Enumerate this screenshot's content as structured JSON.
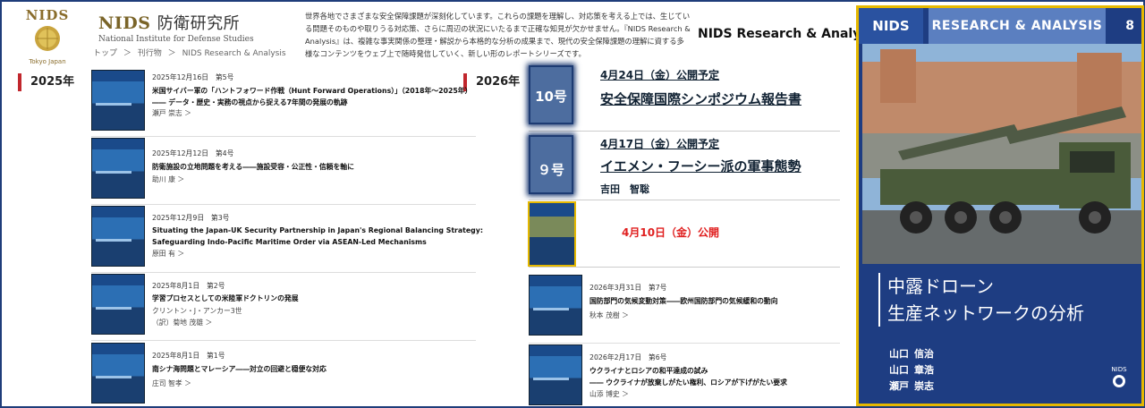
{
  "header": {
    "logo_text": "NIDS",
    "logo_sub": "Tokyo Japan",
    "brand_en": "NIDS",
    "brand_jp": "防衛研究所",
    "brand_sub": "National Institute for Defense Studies",
    "breadcrumbs": [
      "トップ",
      "＞",
      "刊行物",
      "＞",
      "NIDS Research & Analysis"
    ],
    "intro": "世界各地でさまざまな安全保障課題が深刻化しています。これらの課題を理解し、対応策を考える上では、生じている問題そのものや取りうる対応策、さらに周辺の状況にいたるまで正確な知見が欠かせません。『NIDS Research & Analysis』は、複雑な事実関係の整理・解説から本格的な分析の成果まで、現代の安全保障課題の理解に資する多様なコンテンツをウェブ上で随時発信していく、新しい形のレポートシリーズです。",
    "title": "NIDS Research & Analysis"
  },
  "years": {
    "y2025": "2025年",
    "y2026": "2026年"
  },
  "articles_2025": [
    {
      "meta": "2025年12月16日　第5号",
      "title": "米国サイバー軍の「ハントフォワード作戦（Hunt Forward Operations）」（2018年〜2025年）",
      "title2": "―― データ・歴史・実務の視点から捉える7年間の発展の軌跡",
      "author": "瀬戸 崇志 ＞"
    },
    {
      "meta": "2025年12月12日　第4号",
      "title": "防衛施設の立地問題を考える――施設受容・公正性・信頼を軸に",
      "title2": "",
      "author": "助川 康 ＞"
    },
    {
      "meta": "2025年12月9日　第3号",
      "title": "Situating the Japan-UK Security Partnership in Japan's Regional Balancing Strategy:",
      "title2": "Safeguarding Indo-Pacific Maritime Order via ASEAN-Led Mechanisms",
      "author": "原田 有 ＞"
    },
    {
      "meta": "2025年8月1日　第2号",
      "title": "学習プロセスとしての米陸軍ドクトリンの発展",
      "title2": "クリントン・J・アンカー3世",
      "author": "（訳）菊地 茂雄 ＞"
    },
    {
      "meta": "2025年8月1日　第1号",
      "title": "南シナ海問題とマレーシア――対立の回避と穏便な対応",
      "title2": "",
      "author": "庄司 智孝 ＞"
    }
  ],
  "announcements": [
    {
      "num": "10号",
      "date": "4月24日（金）公開予定",
      "title": "安全保障国際シンポジウム報告書",
      "author": ""
    },
    {
      "num": "９号",
      "date": "4月17日（金）公開予定",
      "title": "イエメン・フーシー派の軍事態勢",
      "author": "吉田　智聡"
    }
  ],
  "published_date": "4月10日（金）公開",
  "articles_2026": [
    {
      "meta": "2026年3月31日　第7号",
      "title": "国防部門の気候変動対策――欧州国防部門の気候緩和の動向",
      "title2": "",
      "author": "秋本 茂樹 ＞"
    },
    {
      "meta": "2026年2月17日　第6号",
      "title": "ウクライナとロシアの和平達成の試み",
      "title2": "―― ウクライナが放棄しがたい権利、ロシアが下げがたい要求",
      "author": "山添 博史 ＞"
    }
  ],
  "cover": {
    "nids": "NIDS",
    "series": "RESEARCH & ANALYSIS",
    "number": "8",
    "title_line1": "中露ドローン",
    "title_line2": "生産ネットワークの分析",
    "authors": [
      {
        "family": "山口",
        "given": "信治"
      },
      {
        "family": "山口",
        "given": "章浩"
      },
      {
        "family": "瀬戸",
        "given": "崇志"
      }
    ],
    "foot_logo": "NIDS"
  },
  "colors": {
    "accent_red": "#c1272d",
    "navy": "#1e3d82",
    "gold": "#e5b800"
  }
}
